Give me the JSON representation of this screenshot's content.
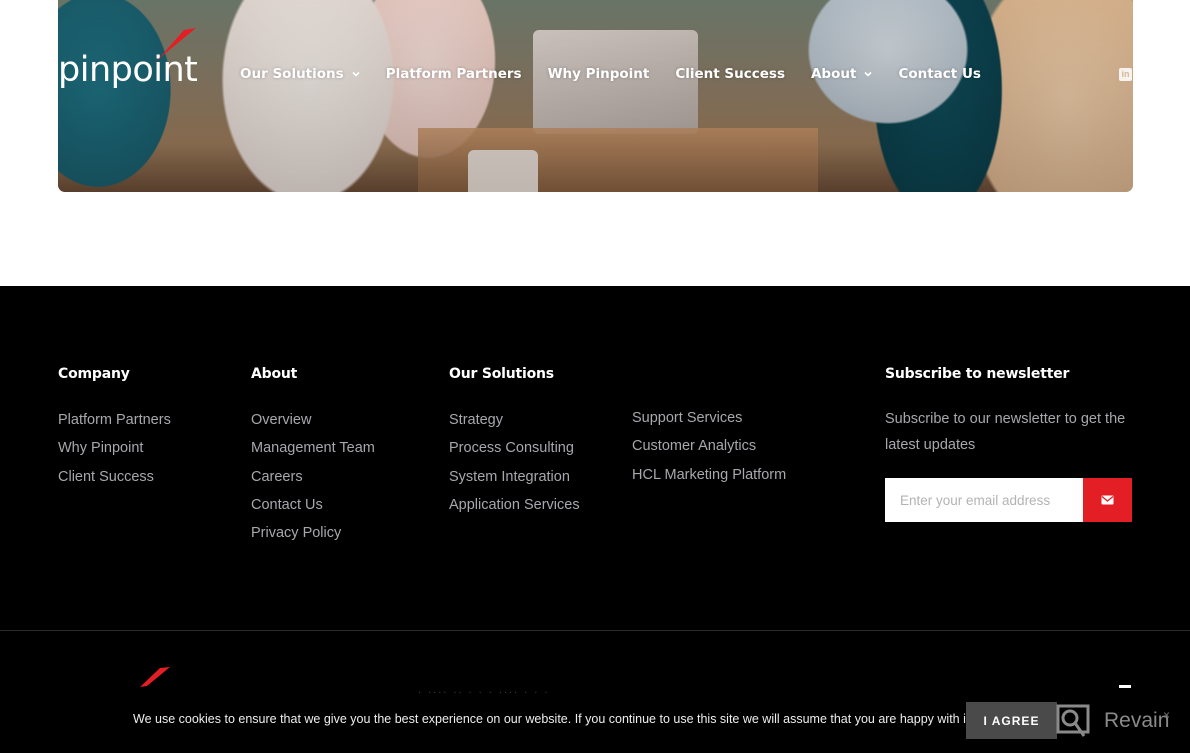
{
  "header": {
    "logo_text": "pinpoint",
    "nav": [
      {
        "label": "Our Solutions",
        "has_dropdown": true
      },
      {
        "label": "Platform Partners",
        "has_dropdown": false
      },
      {
        "label": "Why Pinpoint",
        "has_dropdown": false
      },
      {
        "label": "Client Success",
        "has_dropdown": false
      },
      {
        "label": "About",
        "has_dropdown": true
      },
      {
        "label": "Contact Us",
        "has_dropdown": false
      }
    ],
    "social": {
      "linkedin_glyph": "in"
    }
  },
  "footer": {
    "company": {
      "heading": "Company",
      "links": [
        "Platform Partners",
        "Why Pinpoint",
        "Client Success"
      ]
    },
    "about": {
      "heading": "About",
      "links": [
        "Overview",
        "Management Team",
        "Careers",
        "Contact Us",
        "Privacy Policy"
      ]
    },
    "solutions": {
      "heading": "Our Solutions",
      "links_col1": [
        "Strategy",
        "Process Consulting",
        "System Integration",
        "Application Services"
      ],
      "links_col2": [
        "Support Services",
        "Customer Analytics",
        "HCL Marketing Platform"
      ]
    },
    "newsletter": {
      "heading": "Subscribe to newsletter",
      "description": "Subscribe to our newsletter to get the latest updates",
      "email_placeholder": "Enter your email address",
      "email_value": ""
    }
  },
  "cookie": {
    "message": "We use cookies to ensure that we give you the best experience on our website. If you continue to use this site we will assume that you are happy with it.",
    "agree_label": "I AGREE",
    "close_glyph": "×"
  },
  "widget": {
    "brand": "Revain"
  },
  "colors": {
    "accent_red": "#e31e24",
    "footer_bg": "#000000",
    "link_gray": "#a7a7ad"
  }
}
